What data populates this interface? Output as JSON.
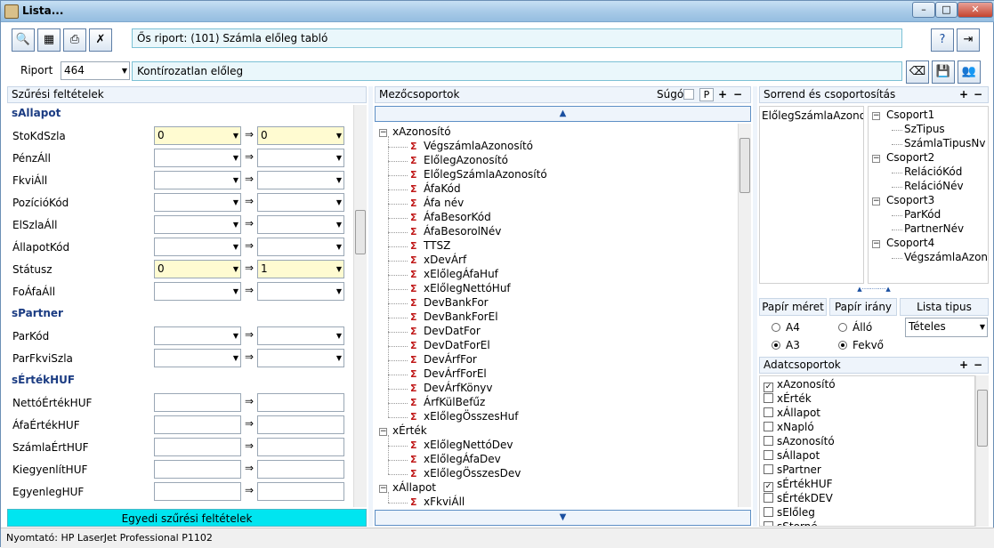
{
  "window": {
    "title": "Lista..."
  },
  "header": {
    "parent_report": "Ős riport: (101)  Számla előleg tabló",
    "report_label": "Riport",
    "report_value": "464",
    "report_name": "Kontírozatlan előleg"
  },
  "left": {
    "title": "Szűrési feltételek",
    "sections": [
      {
        "name": "sAllapot",
        "rows": [
          {
            "label": "StoKdSzla",
            "v1": "0",
            "v2": "0",
            "yellow": true,
            "combo": true
          },
          {
            "label": "PénzÁll",
            "v1": "",
            "v2": "",
            "yellow": false,
            "combo": true
          },
          {
            "label": "FkviÁll",
            "v1": "",
            "v2": "",
            "yellow": false,
            "combo": true
          },
          {
            "label": "PozícióKód",
            "v1": "",
            "v2": "",
            "yellow": false,
            "combo": true
          },
          {
            "label": "ElSzlaÁll",
            "v1": "",
            "v2": "",
            "yellow": false,
            "combo": true
          },
          {
            "label": "ÁllapotKód",
            "v1": "",
            "v2": "",
            "yellow": false,
            "combo": true
          },
          {
            "label": "Státusz",
            "v1": "0",
            "v2": "1",
            "yellow": true,
            "combo": true
          },
          {
            "label": "FoÁfaÁll",
            "v1": "",
            "v2": "",
            "yellow": false,
            "combo": true
          }
        ]
      },
      {
        "name": "sPartner",
        "rows": [
          {
            "label": "ParKód",
            "v1": "",
            "v2": "",
            "yellow": false,
            "combo": true
          },
          {
            "label": "ParFkviSzla",
            "v1": "",
            "v2": "",
            "yellow": false,
            "combo": true
          }
        ]
      },
      {
        "name": "sÉrtékHUF",
        "rows": [
          {
            "label": "NettóÉrtékHUF",
            "v1": "",
            "v2": "",
            "yellow": false,
            "combo": false
          },
          {
            "label": "ÁfaÉrtékHUF",
            "v1": "",
            "v2": "",
            "yellow": false,
            "combo": false
          },
          {
            "label": "SzámlaÉrtHUF",
            "v1": "",
            "v2": "",
            "yellow": false,
            "combo": false
          },
          {
            "label": "KiegyenlítHUF",
            "v1": "",
            "v2": "",
            "yellow": false,
            "combo": false
          },
          {
            "label": "EgyenlegHUF",
            "v1": "",
            "v2": "",
            "yellow": false,
            "combo": false
          }
        ]
      }
    ],
    "arrow": "⇒",
    "custom_button": "Egyedi szűrési feltételek"
  },
  "middle": {
    "title": "Mezőcsoportok",
    "help_label": "Súgó",
    "p_label": "P",
    "groups": [
      {
        "name": "xAzonosító",
        "items": [
          "VégszámlaAzonosító",
          "ElőlegAzonosító",
          "ElőlegSzámlaAzonosító",
          "ÁfaKód",
          "Áfa név",
          "ÁfaBesorKód",
          "ÁfaBesorolNév",
          "TTSZ",
          "xDevÁrf",
          "xElőlegÁfaHuf",
          "xElőlegNettóHuf",
          "DevBankFor",
          "DevBankForEl",
          "DevDatFor",
          "DevDatForEl",
          "DevÁrfFor",
          "DevÁrfForEl",
          "DevÁrfKönyv",
          "ÁrfKülBefűz",
          "xElőlegÖsszesHuf"
        ]
      },
      {
        "name": "xÉrték",
        "items": [
          "xElőlegNettóDev",
          "xElőlegÁfaDev",
          "xElőlegÖsszesDev"
        ]
      },
      {
        "name": "xÁllapot",
        "items": [
          "xFkviÁll"
        ]
      }
    ]
  },
  "right": {
    "sort_title": "Sorrend és csoportosítás",
    "sort_field": "ElőlegSzámlaAzonosít",
    "groups": [
      {
        "name": "Csoport1",
        "items": [
          "SzTipus",
          "SzámlaTipusNv"
        ]
      },
      {
        "name": "Csoport2",
        "items": [
          "RelációKód",
          "RelációNév"
        ]
      },
      {
        "name": "Csoport3",
        "items": [
          "ParKód",
          "PartnerNév"
        ]
      },
      {
        "name": "Csoport4",
        "items": [
          "VégszámlaAzonos"
        ]
      }
    ],
    "paper_size_label": "Papír méret",
    "paper_dir_label": "Papír irány",
    "list_type_label": "Lista tipus",
    "a4": "A4",
    "a3": "A3",
    "allo": "Álló",
    "fekvo": "Fekvő",
    "list_type_value": "Tételes",
    "data_groups_title": "Adatcsoportok",
    "data_groups": [
      {
        "name": "xAzonosító",
        "checked": true
      },
      {
        "name": "xÉrték",
        "checked": false
      },
      {
        "name": "xÁllapot",
        "checked": false
      },
      {
        "name": "xNapló",
        "checked": false
      },
      {
        "name": "sAzonosító",
        "checked": false
      },
      {
        "name": "sÁllapot",
        "checked": false
      },
      {
        "name": "sPartner",
        "checked": false
      },
      {
        "name": "sÉrtékHUF",
        "checked": true
      },
      {
        "name": "sÉrtékDEV",
        "checked": false
      },
      {
        "name": "sElőleg",
        "checked": false
      },
      {
        "name": "sStorné",
        "checked": false
      }
    ]
  },
  "status": {
    "printer": "Nyomtató: HP LaserJet Professional P1102"
  }
}
